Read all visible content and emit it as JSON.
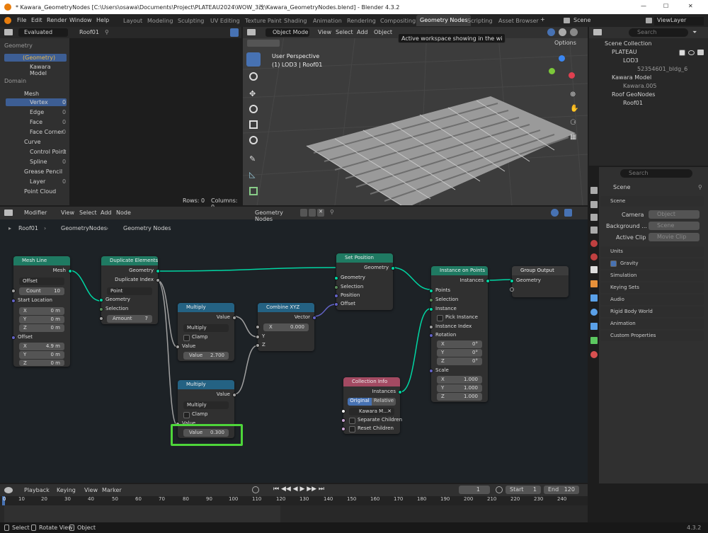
{
  "window": {
    "title": "* Kawara_GeometryNodes [C:\\Users\\osawa\\Documents\\Project\\PLATEAU2024\\WOW_3改\\Kawara_GeometryNodes.blend] - Blender 4.3.2",
    "min": "—",
    "max": "☐",
    "close": "✕"
  },
  "menu": {
    "items": [
      "File",
      "Edit",
      "Render",
      "Window",
      "Help"
    ],
    "tabs": [
      "Layout",
      "Modeling",
      "Sculpting",
      "UV Editing",
      "Texture Paint",
      "Shading",
      "Animation",
      "Rendering",
      "Compositing",
      "Geometry Nodes",
      "Scripting",
      "Asset Browser"
    ],
    "active_tab": "Geometry Nodes",
    "add": "+",
    "scene": "Scene",
    "view_layer": "ViewLayer"
  },
  "tooltip": "Active workspace showing in the window.",
  "spreadsheet": {
    "mode": "Evaluated",
    "object": "Roof01",
    "geometry_label": "Geometry",
    "tree": [
      "(Geometry)",
      "Kawara Model"
    ],
    "domain_label": "Domain",
    "mesh": "Mesh",
    "mesh_items": [
      {
        "label": "Vertex",
        "count": "0"
      },
      {
        "label": "Edge",
        "count": "0"
      },
      {
        "label": "Face",
        "count": "0"
      },
      {
        "label": "Face Corner",
        "count": "0"
      }
    ],
    "curve": "Curve",
    "curve_items": [
      {
        "label": "Control Point",
        "count": "0"
      },
      {
        "label": "Spline",
        "count": "0"
      }
    ],
    "grease": "Grease Pencil",
    "grease_items": [
      {
        "label": "Layer",
        "count": "0"
      }
    ],
    "pointcloud": "Point Cloud",
    "rows": "Rows: 0",
    "columns": "Columns: 0"
  },
  "viewport": {
    "mode": "Object Mode",
    "menus": [
      "View",
      "Select",
      "Add",
      "Object"
    ],
    "options": "Options",
    "persp": "User Perspective",
    "info": "(1) LOD3 | Roof01"
  },
  "outliner": {
    "search": "Search",
    "items": [
      {
        "label": "Scene Collection"
      },
      {
        "label": "PLATEAU"
      },
      {
        "label": "LOD3"
      },
      {
        "label": "52354601_bldg_6"
      },
      {
        "label": "Kawara Model"
      },
      {
        "label": "Kawara.005"
      },
      {
        "label": "Roof GeoNodes"
      },
      {
        "label": "Roof01"
      }
    ]
  },
  "props": {
    "search": "Search",
    "scene": "Scene",
    "scene_sec": "Scene",
    "camera": "Camera",
    "camera_val": "Object",
    "background": "Background ...",
    "background_val": "Scene",
    "clip": "Active Clip",
    "clip_val": "Movie Clip",
    "sections": [
      "Units",
      "Gravity",
      "Simulation",
      "Keying Sets",
      "Audio",
      "Rigid Body World",
      "Animation",
      "Custom Properties"
    ]
  },
  "nodeeditor": {
    "menus": [
      "Modifier",
      "View",
      "Select",
      "Add",
      "Node"
    ],
    "tree": "Geometry Nodes",
    "breadcrumb": [
      "Roof01",
      "GeometryNodes",
      "Geometry Nodes"
    ]
  },
  "nodes": {
    "mesh_line": {
      "title": "Mesh Line",
      "out": "Mesh",
      "mode": "Offset",
      "count_l": "Count",
      "count": "10",
      "start": "Start Location",
      "x": "0 m",
      "y": "0 m",
      "z": "0 m",
      "offset": "Offset",
      "ox": "4.9 m",
      "oy": "0 m",
      "oz": "0 m"
    },
    "dup": {
      "title": "Duplicate Elements",
      "out1": "Geometry",
      "out2": "Duplicate Index",
      "domain": "Point",
      "in1": "Geometry",
      "in2": "Selection",
      "amount_l": "Amount",
      "amount": "7"
    },
    "mul1": {
      "title": "Multiply",
      "out": "Value",
      "op": "Multiply",
      "clamp": "Clamp",
      "in": "Value",
      "val_l": "Value",
      "val": "2.700"
    },
    "mul2": {
      "title": "Multiply",
      "out": "Value",
      "op": "Multiply",
      "clamp": "Clamp",
      "in": "Value",
      "val_l": "Value",
      "val": "0.300"
    },
    "combine": {
      "title": "Combine XYZ",
      "out": "Vector",
      "x_l": "X",
      "x": "0.000",
      "y": "Y",
      "z": "Z"
    },
    "setpos": {
      "title": "Set Position",
      "out": "Geometry",
      "in1": "Geometry",
      "in2": "Selection",
      "in3": "Position",
      "in4": "Offset"
    },
    "collection": {
      "title": "Collection Info",
      "out": "Instances",
      "t1": "Original",
      "t2": "Relative",
      "coll": "Kawara M...",
      "sep": "Separate Children",
      "reset": "Reset Children"
    },
    "iop": {
      "title": "Instance on Points",
      "out": "Instances",
      "points": "Points",
      "selection": "Selection",
      "instance": "Instance",
      "pick": "Pick Instance",
      "index": "Instance Index",
      "rotation": "Rotation",
      "rx": "0°",
      "ry": "0°",
      "rz": "0°",
      "scale": "Scale",
      "sx": "1.000",
      "sy": "1.000",
      "sz": "1.000",
      "x": "X",
      "y": "Y",
      "z": "Z"
    },
    "output": {
      "title": "Group Output",
      "in": "Geometry"
    }
  },
  "timeline": {
    "menus": [
      "Playback",
      "Keying",
      "View",
      "Marker"
    ],
    "frame": "1",
    "start_l": "Start",
    "start": "1",
    "end_l": "End",
    "end": "120",
    "ticks": [
      "0",
      "10",
      "20",
      "30",
      "40",
      "50",
      "60",
      "70",
      "80",
      "90",
      "100",
      "110",
      "120",
      "130",
      "140",
      "150",
      "160",
      "170",
      "180",
      "190",
      "200",
      "210",
      "220",
      "230",
      "240"
    ]
  },
  "status": {
    "items": [
      "Select",
      "Rotate View",
      "Object"
    ],
    "version": "4.3.2"
  }
}
